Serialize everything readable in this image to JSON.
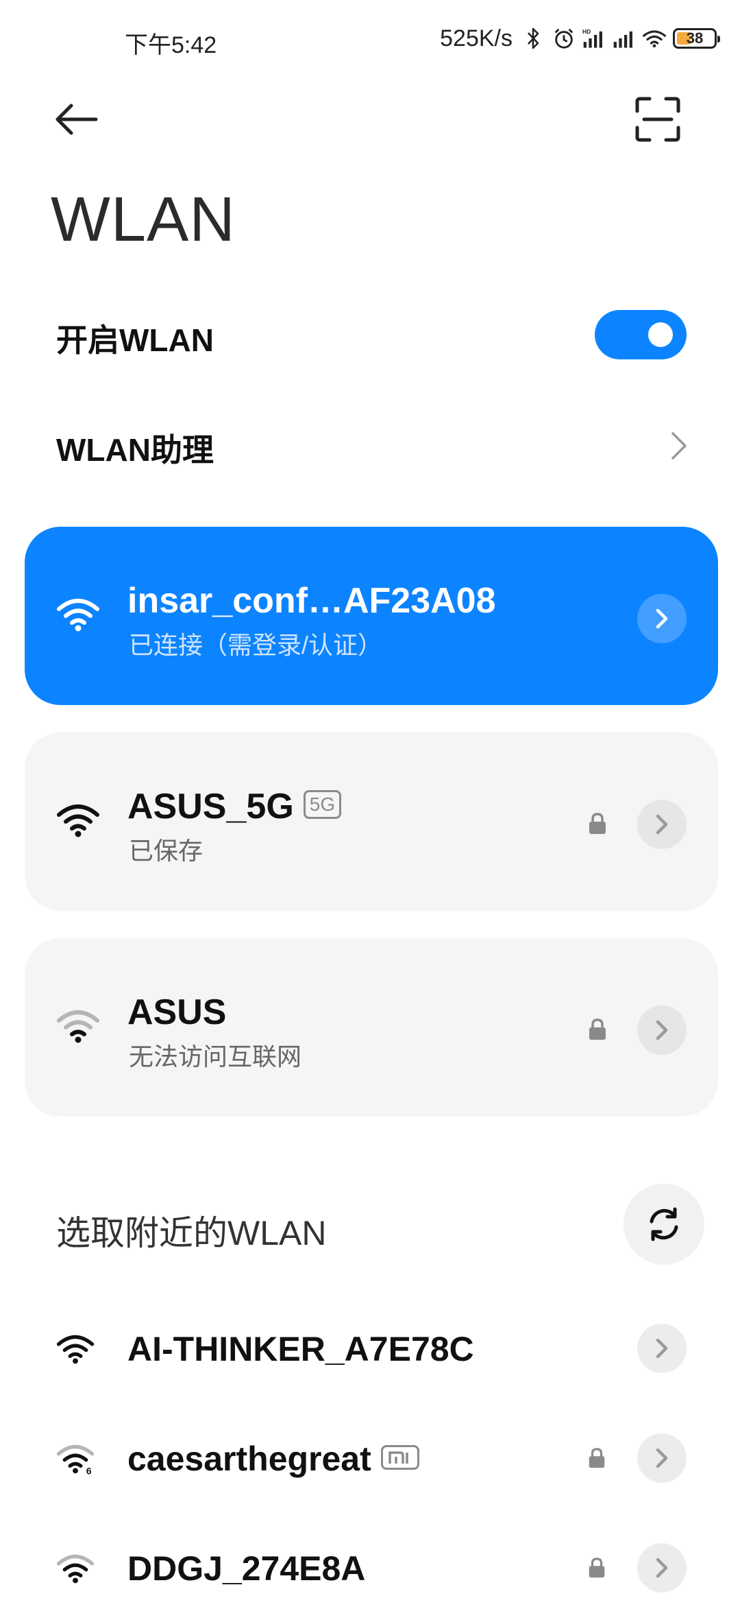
{
  "status_bar": {
    "time": "下午5:42",
    "net_speed": "525K/s",
    "battery": "38",
    "battery_level": 0.38,
    "icons": [
      "bluetooth-icon",
      "alarm-icon",
      "hd-signal-icon",
      "signal-icon",
      "wifi-icon",
      "battery-icon"
    ]
  },
  "header": {
    "back_icon": "back-arrow-icon",
    "scan_icon": "scan-icon",
    "title": "WLAN"
  },
  "settings": {
    "enable_label": "开启WLAN",
    "enable_on": true,
    "assistant_label": "WLAN助理"
  },
  "saved_networks": [
    {
      "ssid": "insar_conf…AF23A08",
      "status": "已连接（需登录/认证）",
      "connected": true,
      "locked": false
    },
    {
      "ssid": "ASUS_5G",
      "badge": "5G",
      "status": "已保存",
      "connected": false,
      "locked": true
    },
    {
      "ssid": "ASUS",
      "status": "无法访问互联网",
      "connected": false,
      "locked": true
    }
  ],
  "nearby": {
    "title": "选取附近的WLAN",
    "refresh_icon": "refresh-icon",
    "networks": [
      {
        "ssid": "AI-THINKER_A7E78C",
        "locked": false
      },
      {
        "ssid": "caesarthegreat",
        "badge_icon": "mi-icon",
        "wifi6": true,
        "locked": true
      },
      {
        "ssid": "DDGJ_274E8A",
        "locked": true
      }
    ]
  },
  "colors": {
    "accent": "#0d84ff",
    "card_grey": "#f5f5f5",
    "battery": "#f3a93b"
  }
}
